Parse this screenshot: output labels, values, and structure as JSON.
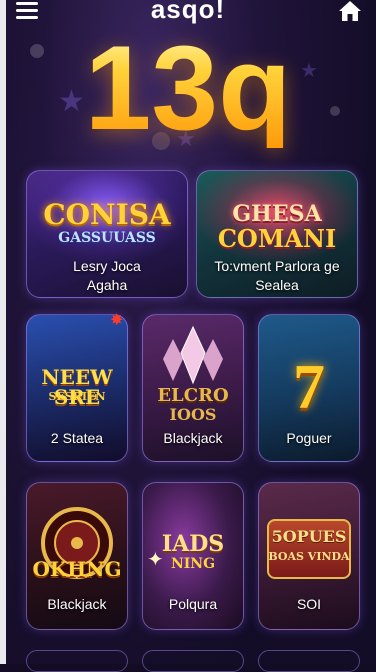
{
  "header": {
    "title": "asqo!",
    "menu_icon": "menu-icon",
    "home_icon": "home-icon"
  },
  "hero": {
    "number": "13q"
  },
  "featured": [
    {
      "logo_line1": "CONISA",
      "logo_line2": "GASSUUASS",
      "title_line1": "Lesry Joca",
      "title_line2": "Agaha"
    },
    {
      "logo_line1": "GHESA",
      "logo_line2": "COMANI",
      "title_line1": "To:vment Parlora ge",
      "title_line2": "Sealea"
    }
  ],
  "games_row1": [
    {
      "logo_line1": "NEEW SRE",
      "logo_line2": "SESRIEN",
      "title": "2 Statea"
    },
    {
      "logo_line1": "ELCRO",
      "logo_line2": "IOOS",
      "title": "Blackjack"
    },
    {
      "logo": "7",
      "title": "Poguer"
    }
  ],
  "games_row2": [
    {
      "logo": "OKHNG",
      "title": "Blackjack"
    },
    {
      "logo_line1": "IADS",
      "logo_line2": "NING",
      "title": "Polqura"
    },
    {
      "logo_line1": "5OPUES",
      "logo_line2": "BOAS VINDA",
      "title": "SOI"
    }
  ],
  "colors": {
    "background": "#140d28",
    "hero_gold": "#ffc21a",
    "card_border": "#a98cff"
  }
}
